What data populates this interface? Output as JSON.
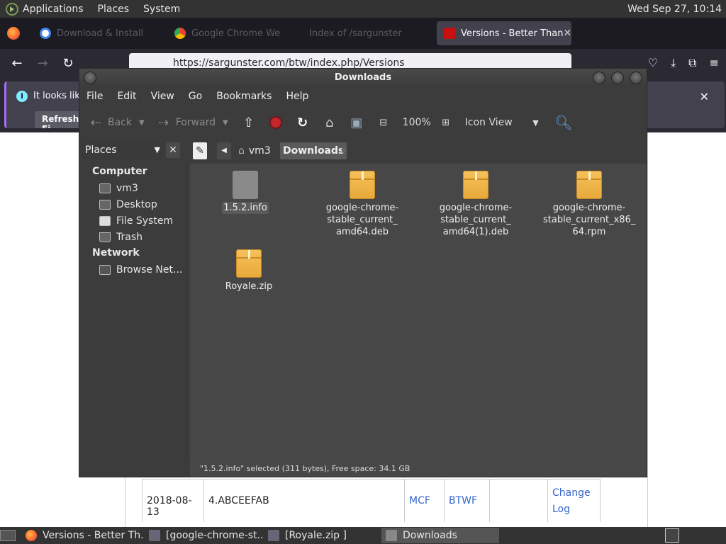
{
  "top_panel": {
    "menus": [
      "Applications",
      "Places",
      "System"
    ],
    "clock": "Wed Sep 27, 10:14"
  },
  "browser": {
    "tabs": [
      {
        "label": "Download & Install",
        "active": false
      },
      {
        "label": "Google Chrome We",
        "active": false
      },
      {
        "label": "Index of /sargunster",
        "active": false
      },
      {
        "label": "Versions - Better Than",
        "active": true
      }
    ],
    "url": "https://sargunster.com/btw/index.php/Versions",
    "notification": {
      "message": "It looks like",
      "refresh_label": "Refresh Fi"
    }
  },
  "wiki_table": {
    "row": {
      "date": "2018-08-13",
      "version": "4.ABCEEFAB",
      "mcf_link": "MCF",
      "btwf_link": "BTWF",
      "changelog": "Change Log"
    }
  },
  "file_manager": {
    "title": "Downloads",
    "menu": [
      "File",
      "Edit",
      "View",
      "Go",
      "Bookmarks",
      "Help"
    ],
    "toolbar": {
      "back": "Back",
      "forward": "Forward",
      "zoom": "100%",
      "view_mode": "Icon View"
    },
    "sidebar_selector": "Places",
    "breadcrumb": [
      "vm3",
      "Downloads"
    ],
    "sidebar": {
      "computer_heading": "Computer",
      "computer_items": [
        "vm3",
        "Desktop",
        "File System",
        "Trash"
      ],
      "network_heading": "Network",
      "network_items": [
        "Browse Net..."
      ]
    },
    "files": [
      {
        "name": "1.5.2.info",
        "type": "doc",
        "selected": true
      },
      {
        "name": "google-chrome-stable_current_amd64.deb",
        "name_lines": [
          "google-chrome-",
          "stable_current_",
          "amd64.deb"
        ],
        "type": "package"
      },
      {
        "name": "google-chrome-stable_current_amd64(1).deb",
        "name_lines": [
          "google-chrome-",
          "stable_current_",
          "amd64(1).deb"
        ],
        "type": "package"
      },
      {
        "name": "google-chrome-stable_current_x86_64.rpm",
        "name_lines": [
          "google-chrome-",
          "stable_current_x86_",
          "64.rpm"
        ],
        "type": "package"
      },
      {
        "name": "Royale.zip",
        "type": "package"
      }
    ],
    "status": "\"1.5.2.info\" selected (311 bytes), Free space: 34.1 GB"
  },
  "taskbar": {
    "tasks": [
      {
        "label": "Versions - Better Th...",
        "active": false
      },
      {
        "label": "[google-chrome-st...",
        "active": false
      },
      {
        "label": "[Royale.zip ]",
        "active": false
      },
      {
        "label": "Downloads",
        "active": true
      }
    ]
  }
}
